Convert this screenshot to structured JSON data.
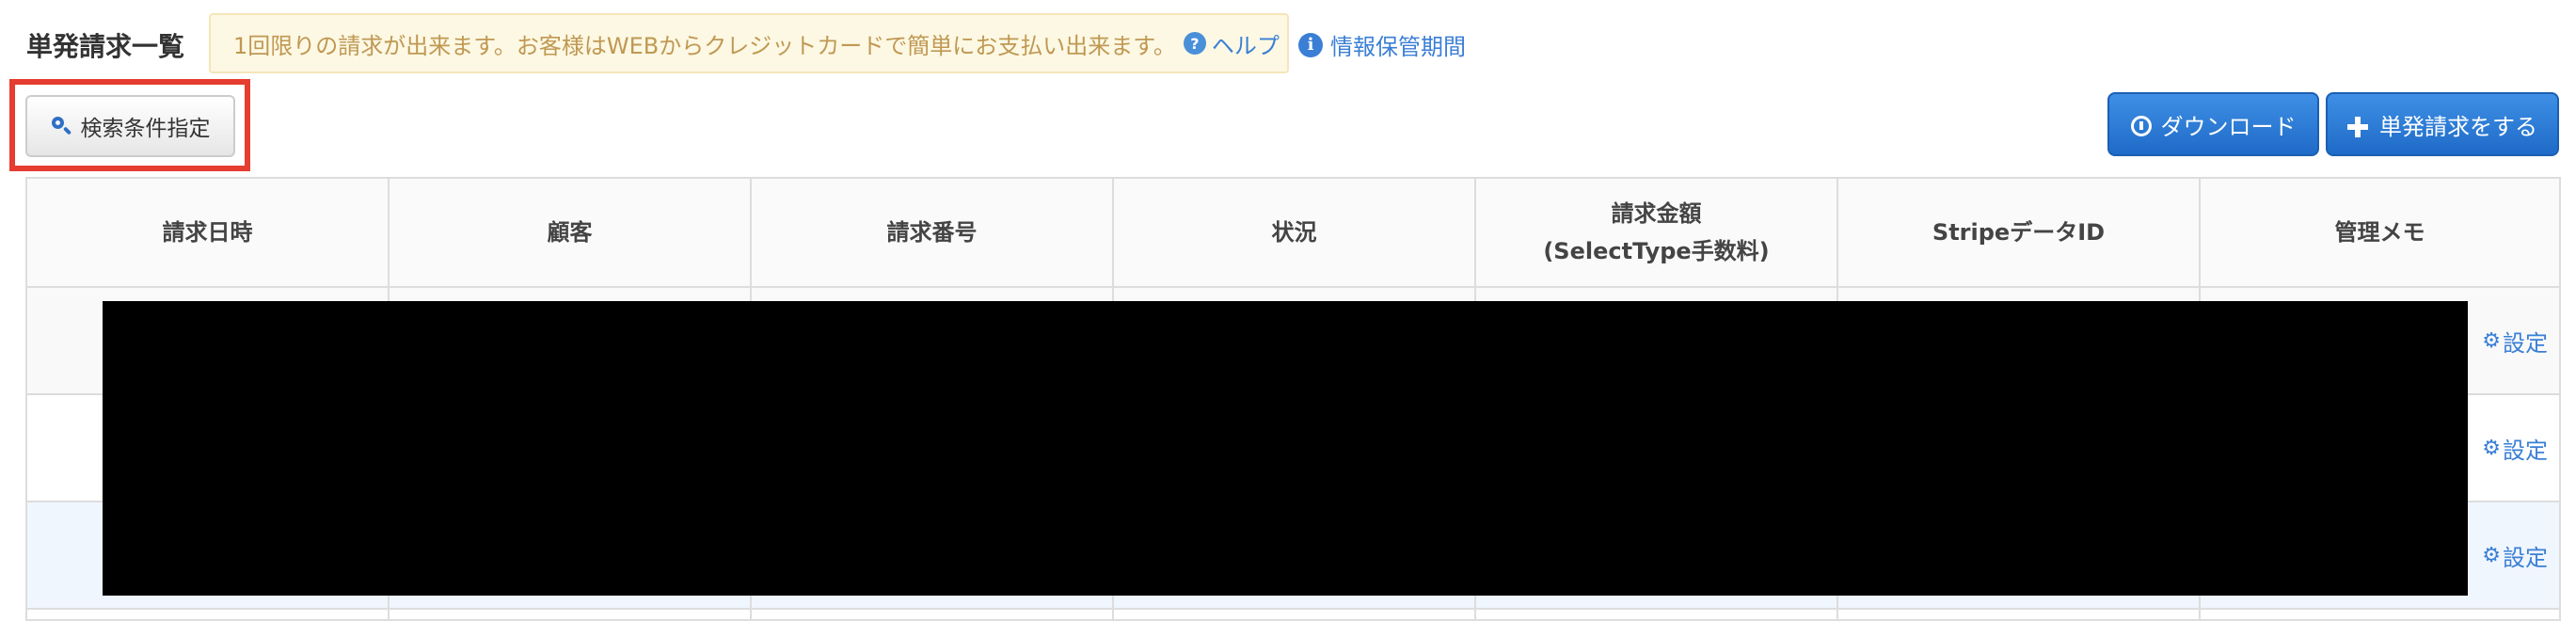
{
  "header": {
    "title": "単発請求一覧",
    "notice_text": "1回限りの請求が出来ます。お客様はWEBからクレジットカードで簡単にお支払い出来ます。",
    "help_icon": "?",
    "help_label": "ヘルプ",
    "info_icon": "i",
    "retention_label": "情報保管期間"
  },
  "toolbar": {
    "search_label": "検索条件指定",
    "download_label": "ダウンロード",
    "new_bill_label": "単発請求をする"
  },
  "table": {
    "headers": [
      "請求日時",
      "顧客",
      "請求番号",
      "状況",
      "請求金額",
      "StripeデータID",
      "管理メモ"
    ],
    "header_amount_sub": "(SelectType手数料)",
    "rows": [
      {
        "action": "設定"
      },
      {
        "action": "設定"
      },
      {
        "action": "設定"
      }
    ]
  },
  "colors": {
    "accent": "#3a7fd5",
    "highlight_border": "#e53d2f",
    "notice_bg": "#fcf8e3",
    "redaction": "#000000"
  }
}
